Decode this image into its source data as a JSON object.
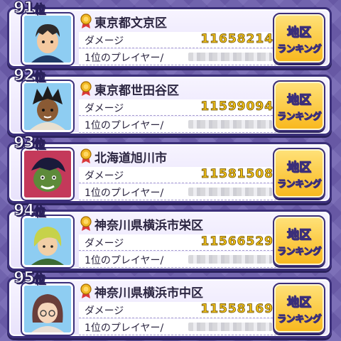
{
  "colors": {
    "background": "#6e5fb0",
    "card_border": "#3b2f7a",
    "score": "#f2c31a",
    "button": "#f8b71c"
  },
  "entries": [
    {
      "rank": "91",
      "rank_suffix": "位",
      "location": "東京都文京区",
      "damage_label": "ダメージ",
      "damage": "11658214",
      "player_label": "1位のプレイヤー/",
      "button_line1": "地区",
      "button_line2": "ランキング"
    },
    {
      "rank": "92",
      "rank_suffix": "位",
      "location": "東京都世田谷区",
      "damage_label": "ダメージ",
      "damage": "11599094",
      "player_label": "1位のプレイヤー/",
      "button_line1": "地区",
      "button_line2": "ランキング"
    },
    {
      "rank": "93",
      "rank_suffix": "位",
      "location": "北海道旭川市",
      "damage_label": "ダメージ",
      "damage": "11581508",
      "player_label": "1位のプレイヤー/",
      "button_line1": "地区",
      "button_line2": "ランキング"
    },
    {
      "rank": "94",
      "rank_suffix": "位",
      "location": "神奈川県横浜市栄区",
      "damage_label": "ダメージ",
      "damage": "11566529",
      "player_label": "1位のプレイヤー/",
      "button_line1": "地区",
      "button_line2": "ランキング"
    },
    {
      "rank": "95",
      "rank_suffix": "位",
      "location": "神奈川県横浜市中区",
      "damage_label": "ダメージ",
      "damage": "11558169",
      "player_label": "1位のプレイヤー/",
      "button_line1": "地区",
      "button_line2": "ランキング"
    }
  ]
}
